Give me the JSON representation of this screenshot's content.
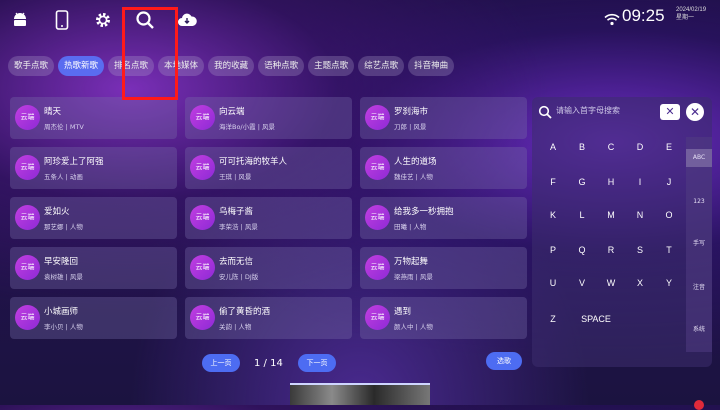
{
  "status": {
    "time": "09:25",
    "date": "2024/02/19",
    "weekday": "星期一"
  },
  "tabs": [
    {
      "label": "歌手点歌",
      "active": false
    },
    {
      "label": "热歌新歌",
      "active": true
    },
    {
      "label": "排名点歌",
      "active": false
    },
    {
      "label": "本地媒体",
      "active": false
    },
    {
      "label": "我的收藏",
      "active": false
    },
    {
      "label": "语种点歌",
      "active": false
    },
    {
      "label": "主题点歌",
      "active": false
    },
    {
      "label": "综艺点歌",
      "active": false
    },
    {
      "label": "抖音神曲",
      "active": false
    }
  ],
  "badge_label": "云端",
  "songs": [
    {
      "title": "晴天",
      "meta": "周杰伦 | MTV"
    },
    {
      "title": "向云端",
      "meta": "海洋Bo/小霞 | 风景"
    },
    {
      "title": "罗刹海市",
      "meta": "刀郎 | 风景"
    },
    {
      "title": "阿珍爱上了阿强",
      "meta": "五条人 | 动画"
    },
    {
      "title": "可可托海的牧羊人",
      "meta": "王琪 | 风景"
    },
    {
      "title": "人生的道场",
      "meta": "魏佳艺 | 人物"
    },
    {
      "title": "爱如火",
      "meta": "那艺娜 | 人物"
    },
    {
      "title": "乌梅子酱",
      "meta": "李荣浩 | 风景"
    },
    {
      "title": "给我多一秒拥抱",
      "meta": "田曦 | 人物"
    },
    {
      "title": "早安隆回",
      "meta": "袁树雄 | 风景"
    },
    {
      "title": "去而无信",
      "meta": "安儿陈 | DJ版"
    },
    {
      "title": "万物起舞",
      "meta": "梁燕雨 | 风景"
    },
    {
      "title": "小城画师",
      "meta": "李小贝 | 人物"
    },
    {
      "title": "偷了黄昏的酒",
      "meta": "关韵 | 人物"
    },
    {
      "title": "遇到",
      "meta": "颜人中 | 人物"
    }
  ],
  "pager": {
    "prev": "上一页",
    "page": "1 / 14",
    "next": "下一页",
    "select": "选歌"
  },
  "keyboard": {
    "placeholder": "请输入首字母搜索",
    "delete": "✕",
    "close": "✕",
    "rows": [
      [
        "A",
        "B",
        "C",
        "D",
        "E"
      ],
      [
        "F",
        "G",
        "H",
        "I",
        "J"
      ],
      [
        "K",
        "L",
        "M",
        "N",
        "O"
      ],
      [
        "P",
        "Q",
        "R",
        "S",
        "T"
      ],
      [
        "U",
        "V",
        "W",
        "X",
        "Y"
      ],
      [
        "Z",
        "SPACE"
      ]
    ],
    "modes": [
      {
        "label": "ABC",
        "active": true
      },
      {
        "label": "123",
        "active": false
      },
      {
        "label": "手写",
        "active": false
      },
      {
        "label": "注音",
        "active": false
      },
      {
        "label": "系统",
        "active": false
      }
    ]
  }
}
